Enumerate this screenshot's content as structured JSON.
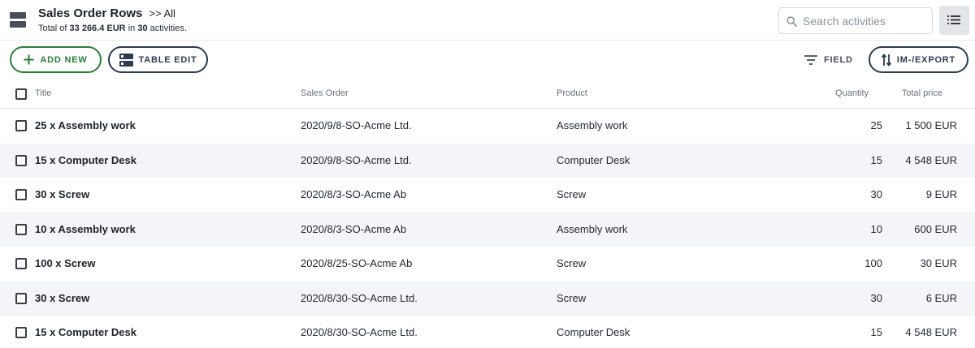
{
  "header": {
    "title": "Sales Order Rows",
    "view": ">> All",
    "summary_prefix": "Total of ",
    "summary_total": "33 266.4 EUR",
    "summary_mid": " in ",
    "summary_count": "30",
    "summary_suffix": " activities."
  },
  "search": {
    "placeholder": "Search activities",
    "value": ""
  },
  "toolbar": {
    "add_new": "ADD NEW",
    "table_edit": "TABLE EDIT",
    "field": "FIELD",
    "import_export": "IM-/EXPORT"
  },
  "colors": {
    "accent_green": "#2f7a3a",
    "navy": "#2c3b4d",
    "row_alt": "#f4f5f8"
  },
  "table": {
    "columns": [
      "Title",
      "Sales Order",
      "Product",
      "Quantity",
      "Total price"
    ],
    "rows": [
      {
        "title": "25 x Assembly work",
        "sales_order": "2020/9/8-SO-Acme Ltd.",
        "product": "Assembly work",
        "quantity": "25",
        "total_price": "1 500 EUR"
      },
      {
        "title": "15 x Computer Desk",
        "sales_order": "2020/9/8-SO-Acme Ltd.",
        "product": "Computer Desk",
        "quantity": "15",
        "total_price": "4 548 EUR"
      },
      {
        "title": "30 x Screw",
        "sales_order": "2020/8/3-SO-Acme Ab",
        "product": "Screw",
        "quantity": "30",
        "total_price": "9 EUR"
      },
      {
        "title": "10 x Assembly work",
        "sales_order": "2020/8/3-SO-Acme Ab",
        "product": "Assembly work",
        "quantity": "10",
        "total_price": "600 EUR"
      },
      {
        "title": "100 x Screw",
        "sales_order": "2020/8/25-SO-Acme Ab",
        "product": "Screw",
        "quantity": "100",
        "total_price": "30 EUR"
      },
      {
        "title": "30 x Screw",
        "sales_order": "2020/8/30-SO-Acme Ltd.",
        "product": "Screw",
        "quantity": "30",
        "total_price": "6 EUR"
      },
      {
        "title": "15 x Computer Desk",
        "sales_order": "2020/8/30-SO-Acme Ltd.",
        "product": "Computer Desk",
        "quantity": "15",
        "total_price": "4 548 EUR"
      }
    ]
  }
}
